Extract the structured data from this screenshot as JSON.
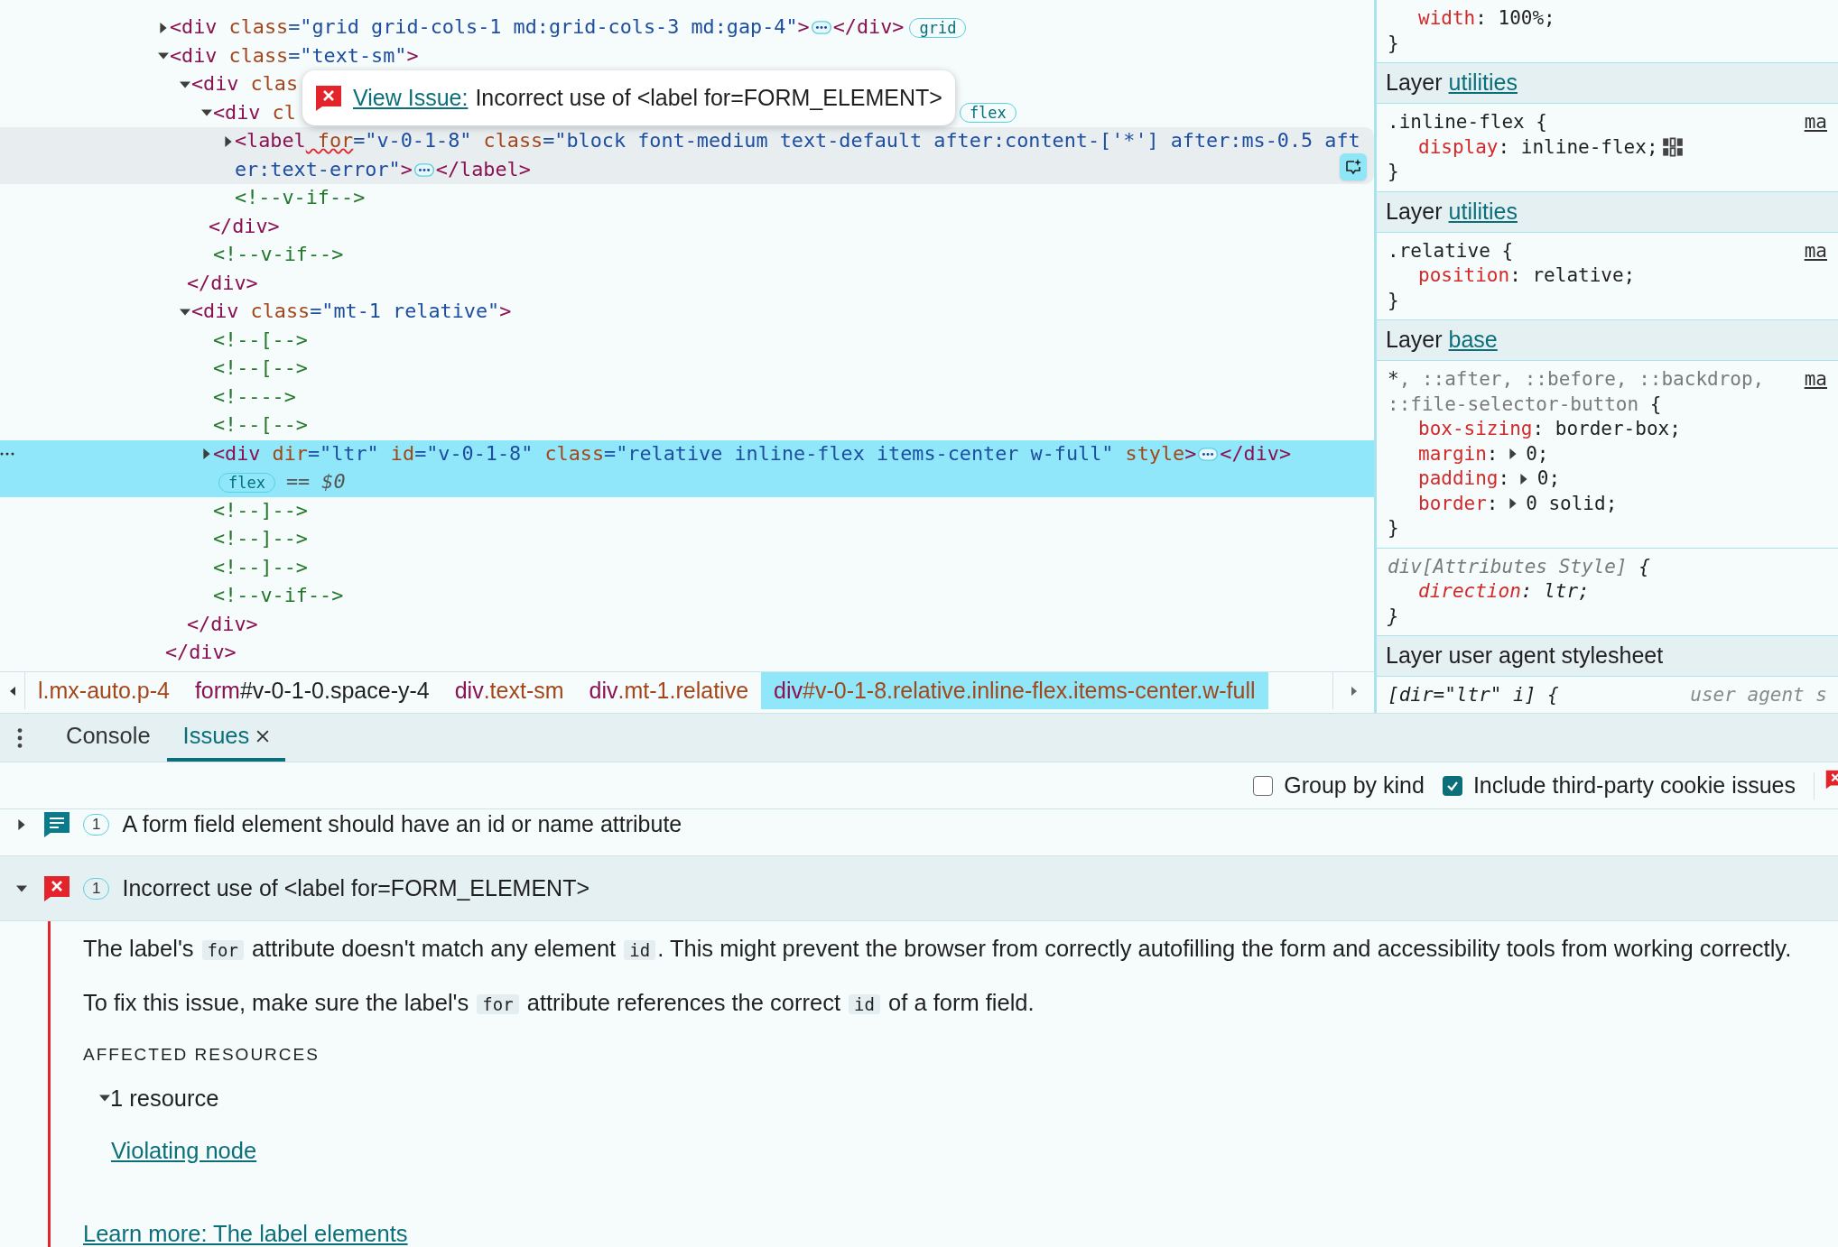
{
  "elements": {
    "nodes": [
      {
        "kind": "element",
        "expanded": false,
        "selected": false,
        "hovered": false,
        "lines": [
          [
            {
              "kind": "tag",
              "text": "<div"
            },
            {
              "kind": "attr",
              "text": " class"
            },
            {
              "kind": "value",
              "text": "=\"grid grid-cols-1 md:grid-cols-3 md:gap-4\""
            },
            {
              "kind": "tag",
              "text": ">"
            },
            {
              "kind": "ellipsis"
            },
            {
              "kind": "tag",
              "text": "</div>"
            },
            {
              "kind": "badge",
              "text": "grid"
            }
          ]
        ]
      },
      {
        "kind": "element",
        "expanded": true,
        "selected": false,
        "hovered": false,
        "lines": [
          [
            {
              "kind": "tag",
              "text": "<div"
            },
            {
              "kind": "attr",
              "text": " class"
            },
            {
              "kind": "value",
              "text": "=\"text-sm\""
            },
            {
              "kind": "tag",
              "text": ">"
            }
          ]
        ],
        "closing": [
          {
            "kind": "tag",
            "text": "</div>"
          }
        ],
        "children": [
          {
            "kind": "element",
            "expanded": true,
            "selected": false,
            "hovered": false,
            "lines": [
              [
                {
                  "kind": "tag",
                  "text": "<div"
                },
                {
                  "kind": "attr",
                  "text": " clas"
                }
              ]
            ],
            "closing": [
              {
                "kind": "tag",
                "text": "</div>"
              }
            ],
            "children": [
              {
                "kind": "element",
                "expanded": true,
                "selected": false,
                "hovered": false,
                "lines": [
                  [
                    {
                      "kind": "tag",
                      "text": "<div"
                    },
                    {
                      "kind": "attr",
                      "text": " cl"
                    },
                    {
                      "kind": "badge",
                      "text": "flex",
                      "gap": true
                    }
                  ]
                ],
                "closing": [
                  {
                    "kind": "tag",
                    "text": "</div>"
                  }
                ],
                "children": [
                  {
                    "kind": "element",
                    "expanded": false,
                    "selected": false,
                    "hovered": true,
                    "ai_button": true,
                    "lines": [
                      [
                        {
                          "kind": "tag",
                          "text": "<label"
                        },
                        {
                          "kind": "attr",
                          "text": " for",
                          "issue": true
                        },
                        {
                          "kind": "value",
                          "text": "=\"v-0-1-8\""
                        },
                        {
                          "kind": "attr",
                          "text": " class"
                        },
                        {
                          "kind": "value",
                          "text": "=\"block font-medium text-default after:content-['*'] after:ms-0.5 aft"
                        }
                      ],
                      [
                        {
                          "kind": "value",
                          "text": "er:text-error\""
                        },
                        {
                          "kind": "tag",
                          "text": ">"
                        },
                        {
                          "kind": "ellipsis"
                        },
                        {
                          "kind": "tag",
                          "text": "</label>"
                        }
                      ]
                    ]
                  },
                  {
                    "kind": "comment",
                    "selected": false,
                    "hovered": false,
                    "lines": [
                      [
                        {
                          "kind": "comment",
                          "text": "<!--v-if-->"
                        }
                      ]
                    ]
                  }
                ]
              },
              {
                "kind": "comment",
                "selected": false,
                "hovered": false,
                "lines": [
                  [
                    {
                      "kind": "comment",
                      "text": "<!--v-if-->"
                    }
                  ]
                ]
              }
            ]
          },
          {
            "kind": "element",
            "expanded": true,
            "selected": false,
            "hovered": false,
            "lines": [
              [
                {
                  "kind": "tag",
                  "text": "<div"
                },
                {
                  "kind": "attr",
                  "text": " class"
                },
                {
                  "kind": "value",
                  "text": "=\"mt-1 relative\""
                },
                {
                  "kind": "tag",
                  "text": ">"
                }
              ]
            ],
            "closing": [
              {
                "kind": "tag",
                "text": "</div>"
              }
            ],
            "children": [
              {
                "kind": "comment",
                "selected": false,
                "hovered": false,
                "lines": [
                  [
                    {
                      "kind": "comment",
                      "text": "<!--[-->"
                    }
                  ]
                ]
              },
              {
                "kind": "comment",
                "selected": false,
                "hovered": false,
                "lines": [
                  [
                    {
                      "kind": "comment",
                      "text": "<!--[-->"
                    }
                  ]
                ]
              },
              {
                "kind": "comment",
                "selected": false,
                "hovered": false,
                "lines": [
                  [
                    {
                      "kind": "comment",
                      "text": "<!---->"
                    }
                  ]
                ]
              },
              {
                "kind": "comment",
                "selected": false,
                "hovered": false,
                "lines": [
                  [
                    {
                      "kind": "comment",
                      "text": "<!--[-->"
                    }
                  ]
                ]
              },
              {
                "kind": "element",
                "expanded": false,
                "selected": true,
                "hovered": false,
                "lines": [
                  [
                    {
                      "kind": "tag",
                      "text": "<div"
                    },
                    {
                      "kind": "attr",
                      "text": " dir"
                    },
                    {
                      "kind": "value",
                      "text": "=\"ltr\""
                    },
                    {
                      "kind": "attr",
                      "text": " id"
                    },
                    {
                      "kind": "value",
                      "text": "=\"v-0-1-8\""
                    },
                    {
                      "kind": "attr",
                      "text": " class"
                    },
                    {
                      "kind": "value",
                      "text": "=\"relative inline-flex items-center w-full\""
                    },
                    {
                      "kind": "attr",
                      "text": " style"
                    },
                    {
                      "kind": "tag",
                      "text": ">"
                    },
                    {
                      "kind": "ellipsis"
                    },
                    {
                      "kind": "tag",
                      "text": "</div>"
                    }
                  ],
                  [
                    {
                      "kind": "badge",
                      "text": "flex"
                    },
                    {
                      "kind": "trailing",
                      "text": "== $0"
                    }
                  ]
                ]
              },
              {
                "kind": "comment",
                "selected": false,
                "hovered": false,
                "lines": [
                  [
                    {
                      "kind": "comment",
                      "text": "<!--]-->"
                    }
                  ]
                ]
              },
              {
                "kind": "comment",
                "selected": false,
                "hovered": false,
                "lines": [
                  [
                    {
                      "kind": "comment",
                      "text": "<!--]-->"
                    }
                  ]
                ]
              },
              {
                "kind": "comment",
                "selected": false,
                "hovered": false,
                "lines": [
                  [
                    {
                      "kind": "comment",
                      "text": "<!--]-->"
                    }
                  ]
                ]
              },
              {
                "kind": "comment",
                "selected": false,
                "hovered": false,
                "lines": [
                  [
                    {
                      "kind": "comment",
                      "text": "<!--v-if-->"
                    }
                  ]
                ]
              }
            ]
          }
        ]
      }
    ],
    "tooltip": {
      "link": "View Issue:",
      "text": "Incorrect use of <label for=FORM_ELEMENT>"
    },
    "breadcrumbs": [
      {
        "rest": "l.mx-auto.p-4",
        "selected": false
      },
      {
        "tag": "form",
        "rest": "#v-0-1-0.space-y-4",
        "selected": false
      },
      {
        "tag": "div",
        "rest": ".text-sm",
        "selected": false
      },
      {
        "tag": "div",
        "rest": ".mt-1.relative",
        "selected": false
      },
      {
        "tag": "div",
        "rest": "#v-0-1-8.relative.inline-flex.items-center.w-full",
        "selected": true
      }
    ]
  },
  "styles": {
    "sections": [
      {
        "kind": "rule",
        "italic": false,
        "declarations": [
          {
            "name": "width",
            "colon": ":",
            "value": " 100%;",
            "expandable": false,
            "flex_editor": false
          }
        ],
        "closing": "}"
      },
      {
        "kind": "layer",
        "label": "Layer",
        "link": "utilities"
      },
      {
        "kind": "rule",
        "italic": false,
        "selector": [
          [
            {
              "text": ".inline-flex {",
              "dim": false
            }
          ]
        ],
        "source": "ma",
        "declarations": [
          {
            "name": "display",
            "colon": ":",
            "value": " inline-flex;",
            "expandable": false,
            "flex_editor": true
          }
        ],
        "closing": "}"
      },
      {
        "kind": "layer",
        "label": "Layer",
        "link": "utilities"
      },
      {
        "kind": "rule",
        "italic": false,
        "selector": [
          [
            {
              "text": ".relative {",
              "dim": false
            }
          ]
        ],
        "source": "ma",
        "declarations": [
          {
            "name": "position",
            "colon": ":",
            "value": " relative;",
            "expandable": false,
            "flex_editor": false
          }
        ],
        "closing": "}"
      },
      {
        "kind": "layer",
        "label": "Layer",
        "link": "base"
      },
      {
        "kind": "rule",
        "italic": false,
        "selector": [
          [
            {
              "text": "*",
              "dim": false
            },
            {
              "text": ", ::after, ::before, ::backdrop,",
              "dim": true
            }
          ],
          [
            {
              "text": "::file-selector-button",
              "dim": true
            },
            {
              "text": " {",
              "dim": false
            }
          ]
        ],
        "source": "ma",
        "declarations": [
          {
            "name": "box-sizing",
            "colon": ":",
            "value": " border-box;",
            "expandable": false,
            "flex_editor": false
          },
          {
            "name": "margin",
            "colon": ":",
            "value": " 0;",
            "expandable": true,
            "flex_editor": false
          },
          {
            "name": "padding",
            "colon": ":",
            "value": " 0;",
            "expandable": true,
            "flex_editor": false
          },
          {
            "name": "border",
            "colon": ":",
            "value": " 0 solid;",
            "expandable": true,
            "flex_editor": false
          }
        ],
        "closing": "}"
      },
      {
        "kind": "rule",
        "italic": true,
        "selector": [
          [
            {
              "text": "div[Attributes Style]",
              "dim": true
            },
            {
              "text": " {",
              "dim": false
            }
          ]
        ],
        "declarations": [
          {
            "name": "direction",
            "colon": ":",
            "value": " ltr;",
            "expandable": false,
            "flex_editor": false
          }
        ],
        "closing": "}"
      },
      {
        "kind": "layer",
        "label": "Layer user agent stylesheet"
      },
      {
        "kind": "rule",
        "italic": true,
        "selector": [
          [
            {
              "text": "[dir=\"ltr\" i] {",
              "dim": false
            }
          ]
        ],
        "source": "user agent s"
      }
    ]
  },
  "drawer": {
    "tabs": [
      {
        "label": "Console",
        "selected": false,
        "closable": false
      },
      {
        "label": "Issues",
        "selected": true,
        "closable": true
      }
    ]
  },
  "issues_toolbar": {
    "options": [
      {
        "label": "Group by kind",
        "checked": false
      },
      {
        "label": "Include third-party cookie issues",
        "checked": true
      }
    ]
  },
  "issues": [
    {
      "kind": "info",
      "count": "1",
      "title": "A form field element should have an id or name attribute",
      "expanded": false
    },
    {
      "kind": "error",
      "count": "1",
      "title": "Incorrect use of <label for=FORM_ELEMENT>",
      "expanded": true,
      "details": {
        "paragraphs": [
          [
            {
              "kind": "text",
              "text": "The label's "
            },
            {
              "kind": "code",
              "text": "for"
            },
            {
              "kind": "text",
              "text": " attribute doesn't match any element "
            },
            {
              "kind": "code",
              "text": "id"
            },
            {
              "kind": "text",
              "text": ". This might prevent the browser from correctly autofilling the form and accessibility tools from working correctly."
            }
          ],
          [
            {
              "kind": "text",
              "text": "To fix this issue, make sure the label's "
            },
            {
              "kind": "code",
              "text": "for"
            },
            {
              "kind": "text",
              "text": " attribute references the correct "
            },
            {
              "kind": "code",
              "text": "id"
            },
            {
              "kind": "text",
              "text": " of a form field."
            }
          ]
        ],
        "resources_heading": "AFFECTED RESOURCES",
        "resources": {
          "label": "1 resource",
          "expanded": true,
          "links": [
            "Violating node"
          ]
        },
        "learn_more": "Learn more: The label elements"
      }
    }
  ]
}
